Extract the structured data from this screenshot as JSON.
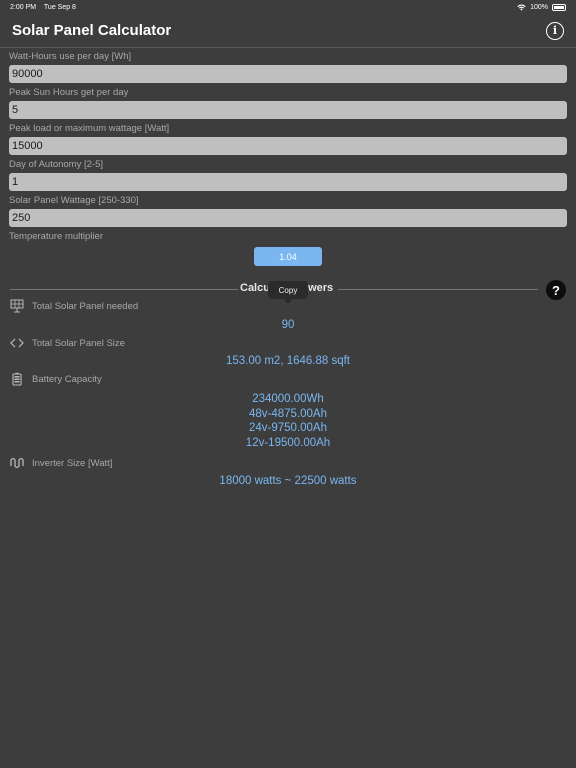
{
  "status": {
    "time": "2:00 PM",
    "date": "Tue Sep 8",
    "battery": "100%"
  },
  "header": {
    "title": "Solar Panel Calculator"
  },
  "form": {
    "fields": [
      {
        "label": "Watt-Hours use per day [Wh]",
        "value": "90000"
      },
      {
        "label": "Peak Sun Hours get per day",
        "value": "5"
      },
      {
        "label": "Peak load or maximum wattage [Watt]",
        "value": "15000"
      },
      {
        "label": "Day of Autonomy [2-5]",
        "value": "1"
      },
      {
        "label": "Solar Panel Wattage [250-330]",
        "value": "250"
      }
    ],
    "temperature_label": "Temperature multiplier",
    "temperature_value": "1.04"
  },
  "answers": {
    "title": "Calcu",
    "title_tail": "swers",
    "copy_tooltip": "Copy",
    "help": "?",
    "solar_panels": {
      "label": "Total Solar Panel needed",
      "value": "90"
    },
    "panel_size": {
      "label": "Total Solar Panel Size",
      "value": "153.00 m2, 1646.88 sqft"
    },
    "battery": {
      "label": "Battery Capacity",
      "lines": [
        "234000.00Wh",
        "48v-4875.00Ah",
        "24v-9750.00Ah",
        "12v-19500.00Ah"
      ]
    },
    "inverter": {
      "label": "Inverter Size [Watt]",
      "value": "18000 watts ~ 22500 watts"
    }
  },
  "colors": {
    "background": "#3d3d3d",
    "accent": "#7ab6f0",
    "input_bg": "#bfbfbf"
  }
}
